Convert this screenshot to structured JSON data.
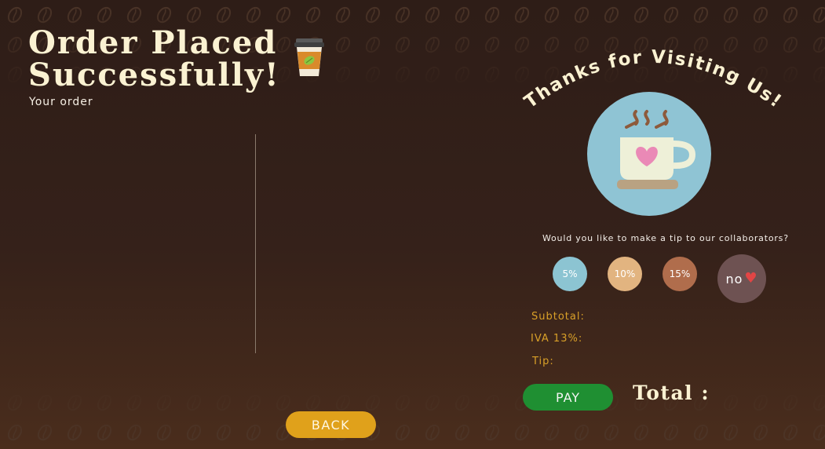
{
  "header": {
    "title_line1": "Order Placed",
    "title_line2": "Successfully!",
    "subtitle": "Your order"
  },
  "thanks": {
    "text": "Thanks for Visiting Us!"
  },
  "tip": {
    "question": "Would you like to make a tip to our collaborators?",
    "options": [
      "5%",
      "10%",
      "15%"
    ],
    "no_label": "no",
    "no_icon": "heart-icon"
  },
  "summary": {
    "subtotal_label": "Subtotal:",
    "iva_label": "IVA 13%:",
    "tip_label": "Tip:",
    "total_label": "Total :"
  },
  "actions": {
    "pay_label": "PAY",
    "back_label": "BACK"
  },
  "colors": {
    "background": "#35211a",
    "title": "#fbf2d2",
    "summary_text": "#d9a028",
    "pay": "#1f8f32",
    "back": "#e0a11b",
    "tip_5": "#8cc4d2",
    "tip_10": "#e2b480",
    "tip_15": "#b06d4c",
    "tip_no": "#6e5252"
  }
}
